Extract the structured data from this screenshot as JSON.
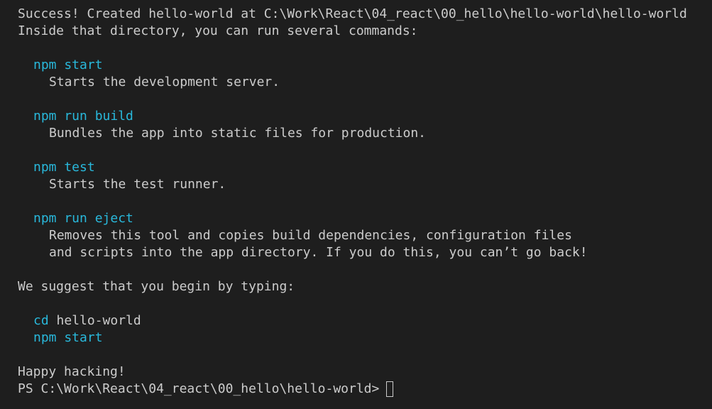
{
  "colors": {
    "background": "#1e1e1e",
    "foreground": "#cccccc",
    "command": "#29b8db"
  },
  "terminal": {
    "success_line": "Success! Created hello-world at C:\\Work\\React\\04_react\\00_hello\\hello-world\\hello-world",
    "inside_line": "Inside that directory, you can run several commands:",
    "commands": [
      {
        "command": "npm start",
        "description": [
          "Starts the development server."
        ]
      },
      {
        "command": "npm run build",
        "description": [
          "Bundles the app into static files for production."
        ]
      },
      {
        "command": "npm test",
        "description": [
          "Starts the test runner."
        ]
      },
      {
        "command": "npm run eject",
        "description": [
          "Removes this tool and copies build dependencies, configuration files",
          "and scripts into the app directory. If you do this, you can’t go back!"
        ]
      }
    ],
    "suggest_line": "We suggest that you begin by typing:",
    "suggest_cd_cmd": "cd",
    "suggest_cd_arg": " hello-world",
    "suggest_start": "npm start",
    "happy_line": "Happy hacking!",
    "prompt": "PS C:\\Work\\React\\04_react\\00_hello\\hello-world>"
  }
}
